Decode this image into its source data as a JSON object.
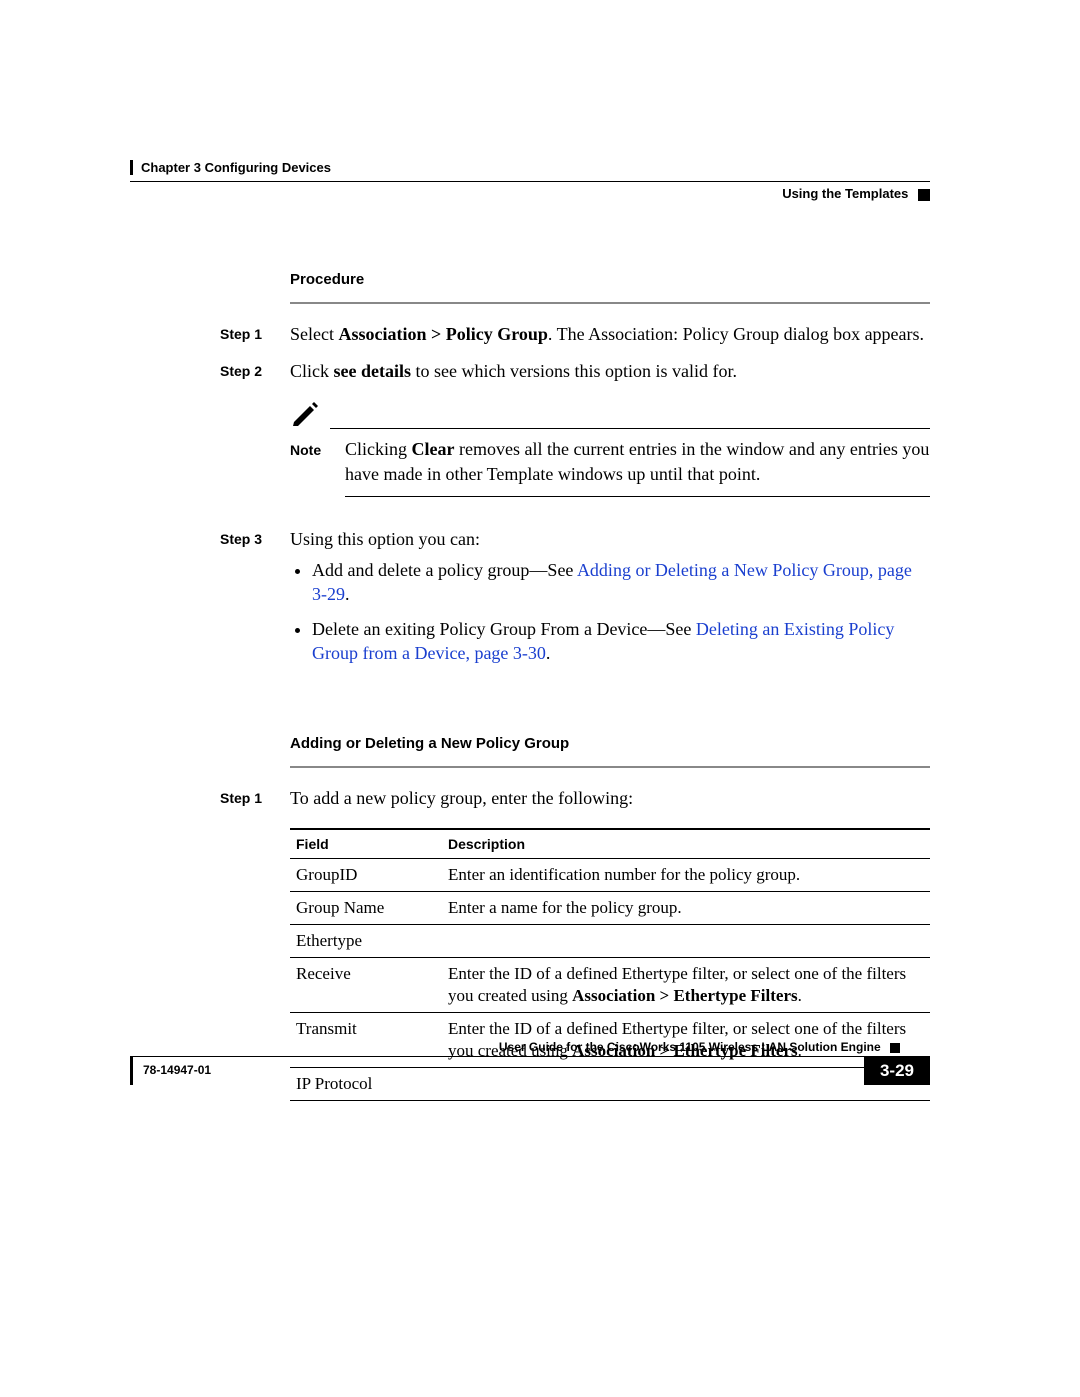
{
  "header": {
    "chapter": "Chapter 3      Configuring Devices",
    "section": "Using the Templates"
  },
  "procedure": {
    "heading": "Procedure",
    "step1": {
      "label": "Step 1",
      "t1": "Select ",
      "b1": "Association > Policy Group",
      "t2": ". The Association: Policy Group dialog box appears."
    },
    "step2": {
      "label": "Step 2",
      "t1": "Click ",
      "b1": "see details",
      "t2": " to see which versions this option is valid for."
    },
    "note": {
      "label": "Note",
      "t1": "Clicking ",
      "b1": "Clear",
      "t2": " removes all the current entries in the window and any entries you have made in other Template windows up until that point."
    },
    "step3": {
      "label": "Step 3",
      "intro": "Using this option you can:",
      "b1a": "Add and delete a policy group—See ",
      "b1link": "Adding or Deleting a New Policy Group, page 3-29",
      "b1b": ".",
      "b2a": "Delete an exiting Policy Group From a Device—See ",
      "b2link": "Deleting an Existing Policy Group from a Device, page 3-30",
      "b2b": "."
    }
  },
  "section2": {
    "heading": "Adding or Deleting a New Policy Group",
    "step1": {
      "label": "Step 1",
      "text": "To add a new policy group, enter the following:"
    },
    "table": {
      "h1": "Field",
      "h2": "Description",
      "r1f": "GroupID",
      "r1d": "Enter an identification number for the policy group.",
      "r2f": "Group Name",
      "r2d": "Enter a name for the policy group.",
      "r3f": "Ethertype",
      "r4f": "Receive",
      "r4d1": "Enter the ID of a defined Ethertype filter, or select one of the filters you created using ",
      "r4db": "Association > Ethertype Filters",
      "r4d2": ".",
      "r5f": "Transmit",
      "r5d1": "Enter the ID of a defined Ethertype filter, or select one of the filters you created using ",
      "r5db": "Association > Ethertype Filters",
      "r5d2": ".",
      "r6f": "IP Protocol"
    }
  },
  "footer": {
    "title": "User Guide for the CiscoWorks 1105 Wireless LAN Solution Engine",
    "docnum": "78-14947-01",
    "pagenum": "3-29"
  }
}
